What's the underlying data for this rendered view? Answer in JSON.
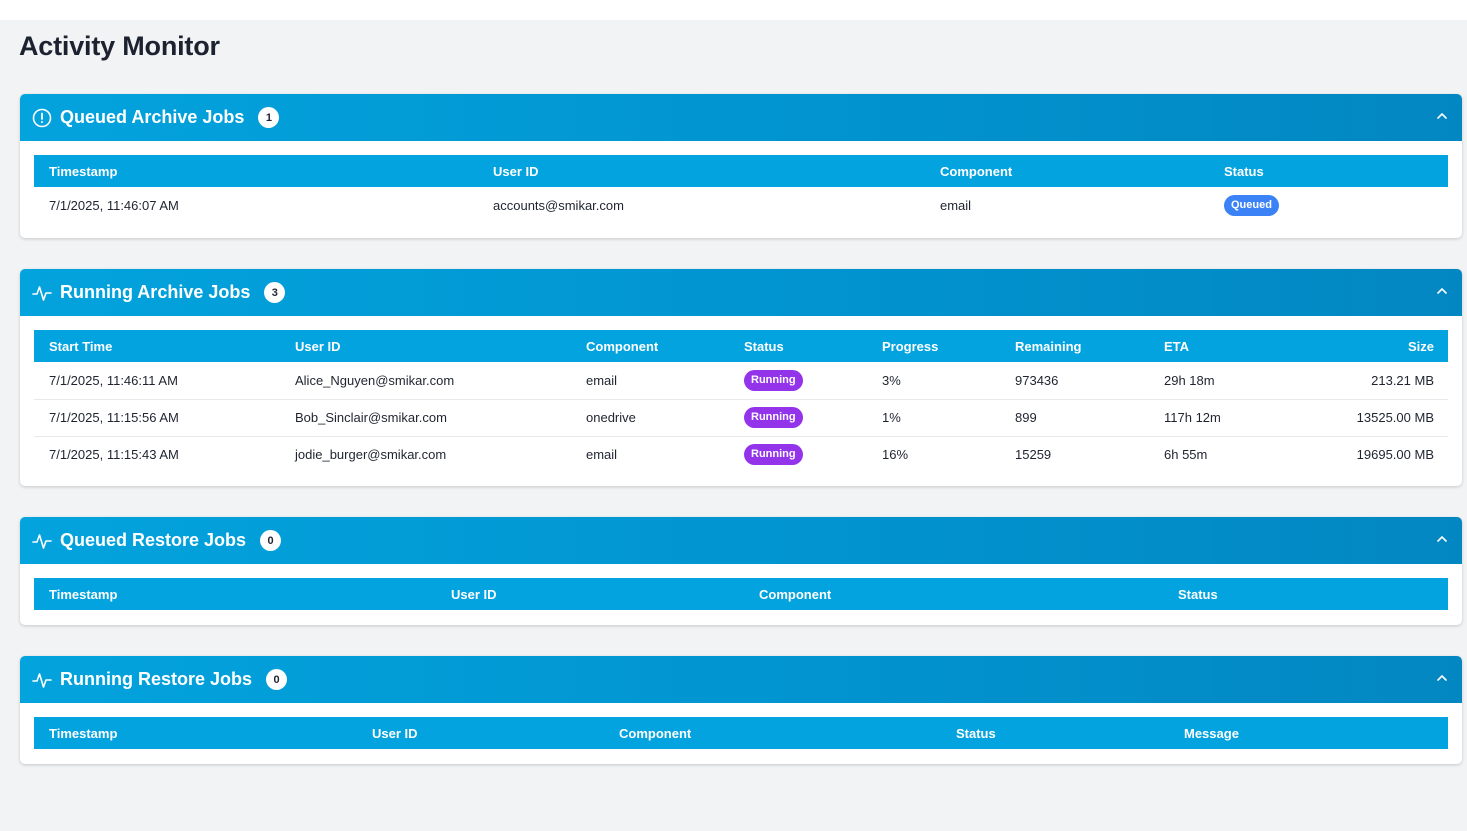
{
  "page": {
    "title": "Activity Monitor"
  },
  "queued_archive": {
    "title": "Queued Archive Jobs",
    "count": "1",
    "icon": "alert-circle-icon",
    "columns": [
      "Timestamp",
      "User ID",
      "Component",
      "Status"
    ],
    "rows": [
      {
        "timestamp": "7/1/2025, 11:46:07 AM",
        "user": "accounts@smikar.com",
        "component": "email",
        "status": "Queued"
      }
    ]
  },
  "running_archive": {
    "title": "Running Archive Jobs",
    "count": "3",
    "icon": "activity-icon",
    "columns": [
      "Start Time",
      "User ID",
      "Component",
      "Status",
      "Progress",
      "Remaining",
      "ETA",
      "Size"
    ],
    "rows": [
      {
        "start": "7/1/2025, 11:46:11 AM",
        "user": "Alice_Nguyen@smikar.com",
        "component": "email",
        "status": "Running",
        "progress": "3%",
        "remaining": "973436",
        "eta": "29h 18m",
        "size": "213.21 MB"
      },
      {
        "start": "7/1/2025, 11:15:56 AM",
        "user": "Bob_Sinclair@smikar.com",
        "component": "onedrive",
        "status": "Running",
        "progress": "1%",
        "remaining": "899",
        "eta": "117h 12m",
        "size": "13525.00 MB"
      },
      {
        "start": "7/1/2025, 11:15:43 AM",
        "user": "jodie_burger@smikar.com",
        "component": "email",
        "status": "Running",
        "progress": "16%",
        "remaining": "15259",
        "eta": "6h 55m",
        "size": "19695.00 MB"
      }
    ]
  },
  "queued_restore": {
    "title": "Queued Restore Jobs",
    "count": "0",
    "icon": "activity-icon",
    "columns": [
      "Timestamp",
      "User ID",
      "Component",
      "Status"
    ]
  },
  "running_restore": {
    "title": "Running Restore Jobs",
    "count": "0",
    "icon": "activity-icon",
    "columns": [
      "Timestamp",
      "User ID",
      "Component",
      "Status",
      "Message"
    ]
  },
  "colors": {
    "header": "#03a3dd",
    "queued_badge": "#3b82f6",
    "running_badge": "#9333ea"
  }
}
